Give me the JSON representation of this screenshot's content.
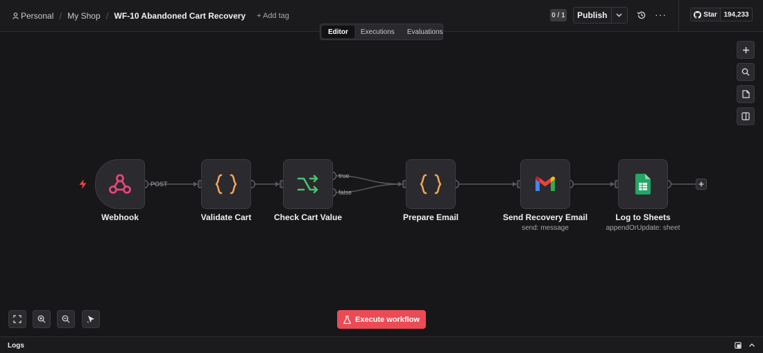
{
  "header": {
    "breadcrumb": [
      "Personal",
      "My Shop"
    ],
    "workflow_name": "WF-10 Abandoned Cart Recovery",
    "add_tag": "+ Add tag",
    "active_count": "0 / 1",
    "publish_label": "Publish",
    "github_star_label": "Star",
    "github_stars": "194,233",
    "tabs": [
      {
        "label": "Editor",
        "active": true
      },
      {
        "label": "Executions",
        "active": false
      },
      {
        "label": "Evaluations",
        "active": false
      }
    ]
  },
  "nodes": [
    {
      "title": "Webhook",
      "subtitle": "",
      "icon": "webhook-icon"
    },
    {
      "title": "Validate Cart",
      "subtitle": "",
      "icon": "code-braces-icon"
    },
    {
      "title": "Check Cart Value",
      "subtitle": "",
      "icon": "if-branch-icon"
    },
    {
      "title": "Prepare Email",
      "subtitle": "",
      "icon": "code-braces-icon"
    },
    {
      "title": "Send Recovery Email",
      "subtitle": "send: message",
      "icon": "gmail-icon"
    },
    {
      "title": "Log to Sheets",
      "subtitle": "appendOrUpdate: sheet",
      "icon": "google-sheets-icon"
    }
  ],
  "edge_labels": {
    "webhook": "POST",
    "true": "true",
    "false": "false"
  },
  "execute_label": "Execute workflow",
  "logs_label": "Logs",
  "colors": {
    "accent": "#ea4b55",
    "trigger_bolt": "#e8453c",
    "webhook": "#e8457c",
    "code": "#f0a45a",
    "if_branch": "#4ac36e",
    "sheets": "#23a566"
  }
}
